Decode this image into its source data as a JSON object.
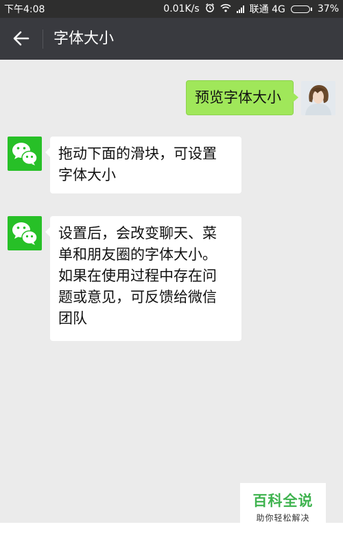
{
  "status_bar": {
    "time": "下午4:08",
    "network_speed": "0.01K/s",
    "carrier": "联通 4G",
    "battery_percent": "37%",
    "battery_level": 0.37
  },
  "header": {
    "title": "字体大小"
  },
  "messages": [
    {
      "sender": "user",
      "text": "预览字体大小"
    },
    {
      "sender": "wechat",
      "lines": [
        "拖动下面的滑块，可设置",
        "字体大小"
      ]
    },
    {
      "sender": "wechat",
      "lines": [
        "设置后，会改变聊天、菜",
        "单和朋友圈的字体大小。",
        "如果在使用过程中存在问",
        "题或意见，可反馈给微信",
        "团队"
      ]
    }
  ],
  "watermark": {
    "title": "百科全说",
    "subtitle": "助你轻松解决"
  },
  "colors": {
    "status_bar": "#2e2e2e",
    "title_bar": "#393a3f",
    "background": "#ebebeb",
    "user_bubble": "#a0e75a",
    "wechat_green": "#27c027",
    "watermark_green": "#3fb34f"
  }
}
